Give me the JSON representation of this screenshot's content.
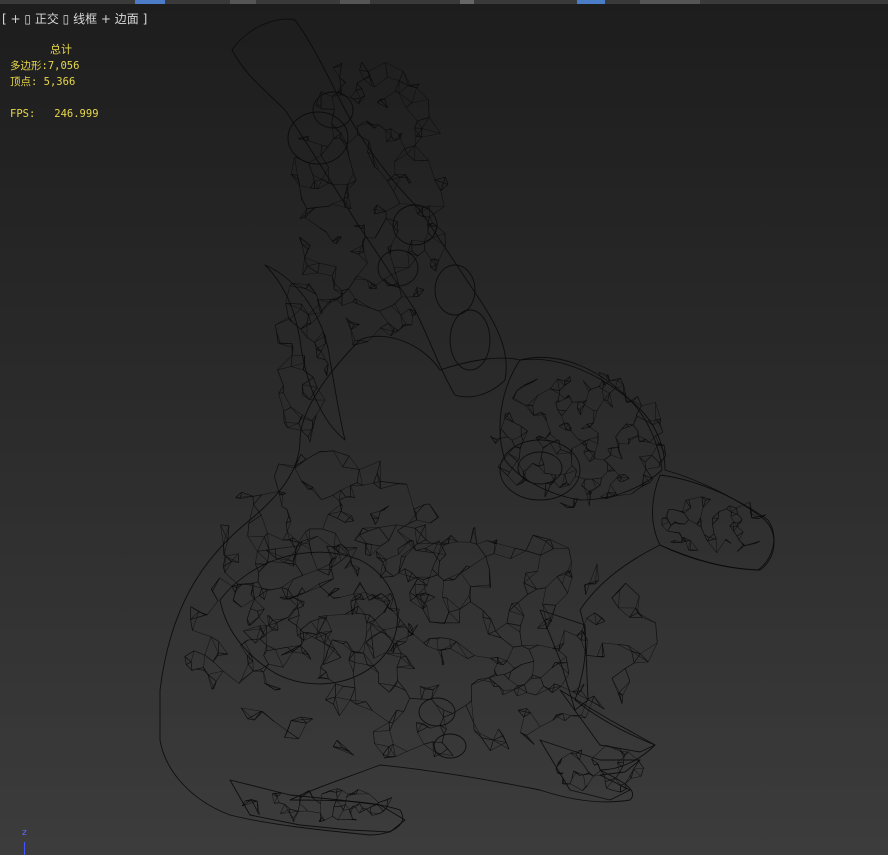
{
  "viewport": {
    "label_parts": [
      "[ + ]",
      "正交",
      "线框 + 边面 ]"
    ],
    "label_separator_icon": "menu-box-icon"
  },
  "stats": {
    "title": "总计",
    "polygons_label": "多边形:",
    "polygons_value": "7,056",
    "vertices_label": "顶点:",
    "vertices_value": "5,366",
    "fps_label": "FPS:",
    "fps_value": "246.999"
  },
  "axis": {
    "label": "z"
  },
  "colors": {
    "stats_text": "#e8d84a",
    "label_text": "#d8d8d8",
    "wire": "#0b0b0b",
    "axis_z": "#4355ff",
    "accent_tab": "#4a7cc8"
  }
}
